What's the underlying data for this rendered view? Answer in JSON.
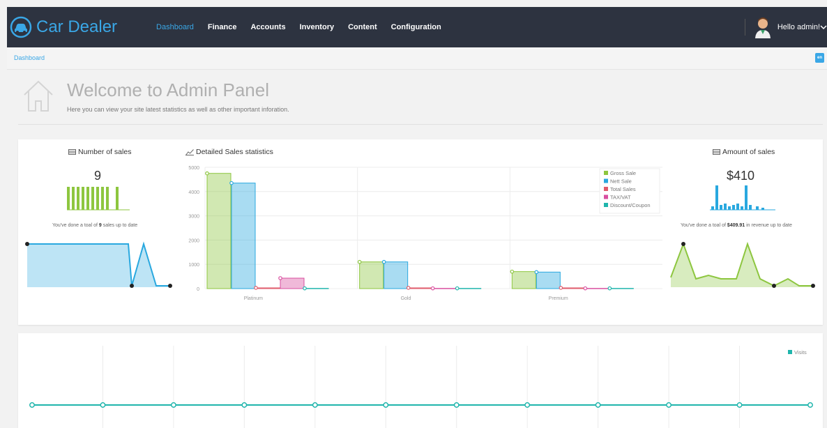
{
  "app": {
    "title": "Car Dealer"
  },
  "nav": {
    "items": [
      {
        "label": "Dashboard",
        "active": true
      },
      {
        "label": "Finance"
      },
      {
        "label": "Accounts"
      },
      {
        "label": "Inventory"
      },
      {
        "label": "Content"
      },
      {
        "label": "Configuration"
      }
    ],
    "greeting": "Hello admin!"
  },
  "breadcrumb": "Dashboard",
  "lang_badge": "en",
  "welcome": {
    "title": "Welcome to Admin Panel",
    "subtitle": "Here you can view your site latest statistics as well as other important inforation."
  },
  "sales_count": {
    "title": "Number of sales",
    "value": "9",
    "note_prefix": "You've done a toal of ",
    "note_value": "9",
    "note_suffix": " sales up to date"
  },
  "sales_amount": {
    "title": "Amount of sales",
    "value": "$410",
    "note_prefix": "You've done a toal of ",
    "note_value": "$409.91",
    "note_suffix": " in revenue up to date"
  },
  "colors": {
    "green": "#8dc63f",
    "blue": "#29a8df",
    "red": "#e05a6a",
    "pink": "#d94fa0",
    "teal": "#1fb5ac",
    "nav_bg": "#2d3340",
    "accent": "#3aa7e6"
  },
  "chart_data": [
    {
      "type": "bar",
      "title": "Detailed Sales statistics",
      "categories": [
        "Platinum",
        "Gold",
        "Premium"
      ],
      "ylim": [
        0,
        5000
      ],
      "yticks": [
        "0",
        "1000",
        "2000",
        "3000",
        "4000",
        "5000"
      ],
      "grid": true,
      "legend_position": "top-right",
      "series": [
        {
          "name": "Gross Sale",
          "color": "#8dc63f",
          "values": [
            4750,
            1100,
            700
          ]
        },
        {
          "name": "Nett Sale",
          "color": "#29a8df",
          "values": [
            4350,
            1100,
            680
          ]
        },
        {
          "name": "Total Sales",
          "color": "#e05a6a",
          "values": [
            30,
            30,
            30
          ]
        },
        {
          "name": "TAX/VAT",
          "color": "#d94fa0",
          "values": [
            430,
            10,
            10
          ]
        },
        {
          "name": "Discount/Coupon",
          "color": "#1fb5ac",
          "values": [
            10,
            10,
            10
          ]
        }
      ]
    },
    {
      "type": "line",
      "title": "Visits",
      "series": [
        {
          "name": "Visits",
          "color": "#1fb5ac",
          "values": [
            0,
            0,
            0,
            0,
            0,
            0,
            0,
            0,
            0,
            0,
            0,
            0
          ]
        }
      ],
      "legend_position": "top-right"
    }
  ]
}
